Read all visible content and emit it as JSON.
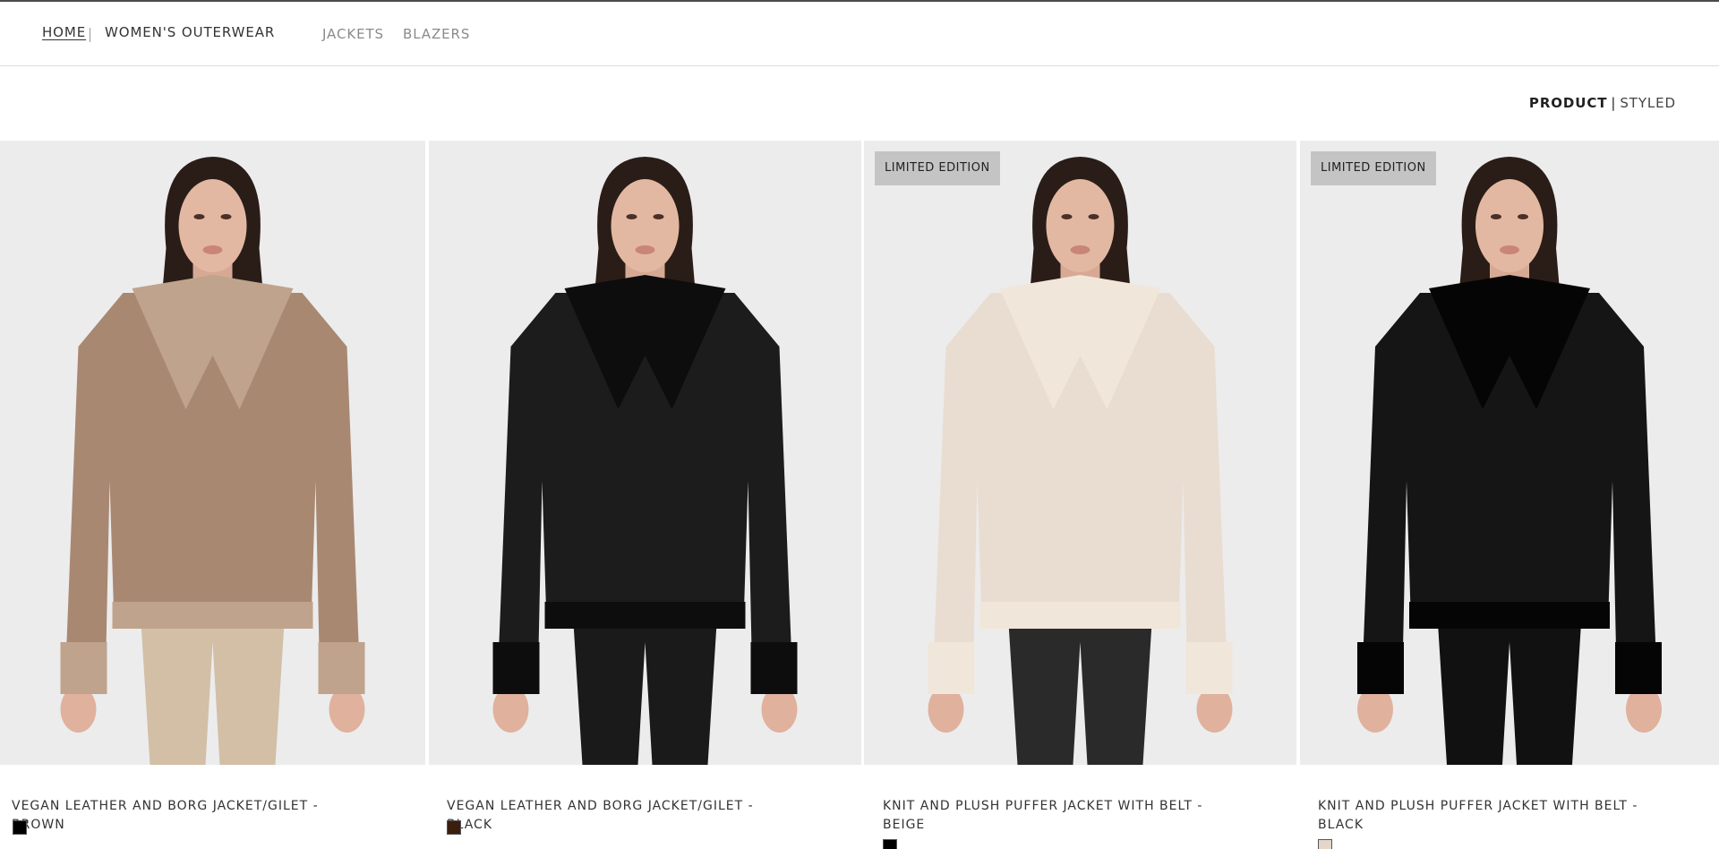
{
  "breadcrumb": {
    "home": "HOME",
    "current": "WOMEN'S OUTERWEAR"
  },
  "subnav": [
    {
      "label": "JACKETS"
    },
    {
      "label": "BLAZERS"
    }
  ],
  "view_toggle": {
    "active": "PRODUCT",
    "separator": "|",
    "inactive": "STYLED"
  },
  "products": [
    {
      "name": "VEGAN LEATHER AND BORG JACKET/GILET - BROWN",
      "badge": "",
      "swatch_color": "#000000",
      "jacket_color": "#a98872",
      "trim_color": "#bfa38c",
      "bottom_color": "#d2bfa6"
    },
    {
      "name": "VEGAN LEATHER AND BORG JACKET/GILET - BLACK",
      "badge": "",
      "swatch_color": "#3a1e0e",
      "jacket_color": "#1c1c1c",
      "trim_color": "#0d0d0d",
      "bottom_color": "#1a1a1a"
    },
    {
      "name": "KNIT AND PLUSH PUFFER JACKET WITH BELT - BEIGE",
      "badge": "LIMITED EDITION",
      "swatch_color": "#000000",
      "jacket_color": "#e9ddd1",
      "trim_color": "#f1e6da",
      "bottom_color": "#2a2a2a"
    },
    {
      "name": "KNIT AND PLUSH PUFFER JACKET WITH BELT - BLACK",
      "badge": "LIMITED EDITION",
      "swatch_color": "#e4d6c8",
      "jacket_color": "#151515",
      "trim_color": "#050505",
      "bottom_color": "#111111"
    }
  ]
}
